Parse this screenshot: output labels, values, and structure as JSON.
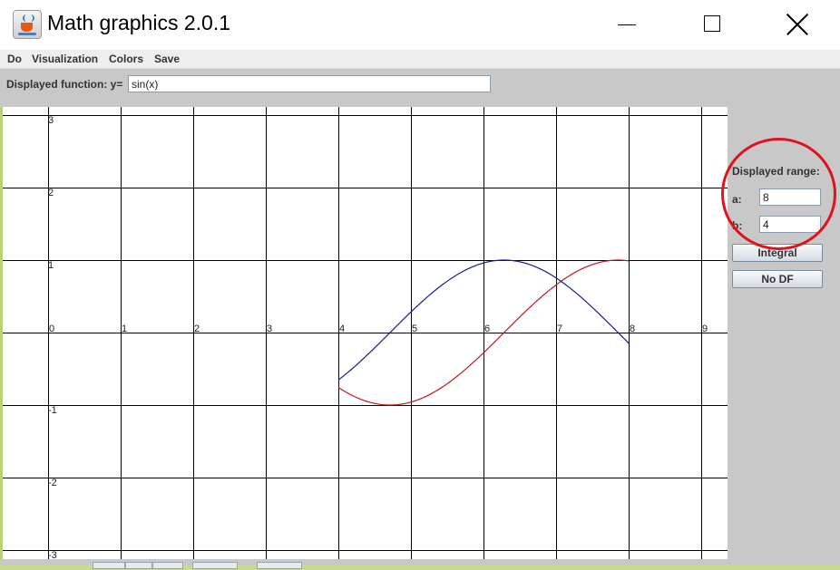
{
  "window": {
    "title": "Math graphics 2.0.1",
    "icon": "java-cup-icon"
  },
  "menu": [
    "Do",
    "Visualization",
    "Colors",
    "Save"
  ],
  "function_bar": {
    "label": "Displayed function: y=",
    "value": "sin(x)"
  },
  "graph": {
    "x_ticks": [
      "0",
      "1",
      "2",
      "3",
      "4",
      "5",
      "6",
      "7",
      "8",
      "9"
    ],
    "y_ticks": [
      "3",
      "2",
      "1",
      "-1",
      "-2",
      "-3"
    ],
    "x_range": [
      0,
      9.3
    ],
    "y_range": [
      -3.1,
      3.1
    ],
    "grid": true,
    "plot_interval": [
      4,
      8
    ],
    "curves": [
      {
        "function": "sin(x)",
        "color": "#c0181f"
      },
      {
        "function": "derivative",
        "color": "#1a1aa0"
      }
    ]
  },
  "range_panel": {
    "title": "Displayed range:",
    "a_label": "a:",
    "a_value": "8",
    "b_label": "b:",
    "b_value": "4",
    "integral_button": "Integral",
    "no_df_button": "No DF"
  },
  "colors": {
    "panel_bg": "#c8c8c8",
    "highlight": "#e0121f",
    "accent_strip": "#c6dc8c"
  }
}
